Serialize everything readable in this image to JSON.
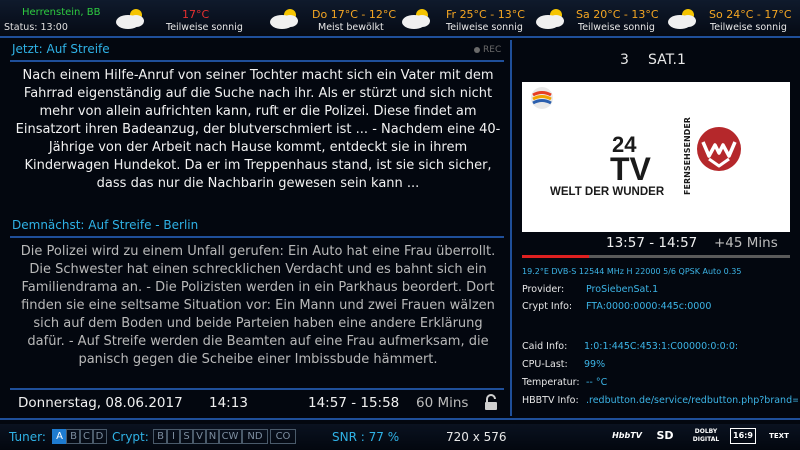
{
  "header": {
    "location": "Herrenstein, BB",
    "status": "Status: 13:00",
    "current_temp": "17°C",
    "current_desc": "Teilweise sonnig",
    "forecast": [
      {
        "day": "Do",
        "temp": "17°C - 12°C",
        "desc": "Meist bewölkt",
        "icon": "cloud-sun-icon"
      },
      {
        "day": "Fr",
        "temp": "25°C - 13°C",
        "desc": "Teilweise sonnig",
        "icon": "cloud-sun-icon"
      },
      {
        "day": "Sa",
        "temp": "20°C - 13°C",
        "desc": "Teilweise sonnig",
        "icon": "cloud-sun-icon"
      },
      {
        "day": "So",
        "temp": "24°C - 17°C",
        "desc": "Teilweise sonnig",
        "icon": "cloud-sun-icon"
      }
    ]
  },
  "now": {
    "title": "Jetzt: Auf Streife",
    "rec": "REC",
    "description": "Nach einem Hilfe-Anruf von seiner  Tochter macht sich ein Vater mit dem Fahrrad eigenständig auf die Suche nach ihr. Als er stürzt und sich nicht mehr von allein aufrichten kann, ruft er die Polizei. Diese findet am Einsatzort ihren Badeanzug, der blutverschmiert ist ... - Nachdem eine 40-Jährige von der Arbeit nach Hause kommt, entdeckt sie in ihrem Kinderwagen Hundekot. Da er im Treppenhaus stand, ist sie sich sicher, dass das nur die Nachbarin gewesen sein kann ..."
  },
  "next": {
    "title": "Demnächst: Auf Streife - Berlin",
    "description": "Die Polizei wird zu einem Unfall gerufen: Ein Auto hat eine Frau überrollt. Die Schwester hat einen schrecklichen Verdacht und es bahnt sich ein Familiendrama an. - Die Polizisten werden in ein Parkhaus beordert. Dort finden sie eine seltsame Situation vor: Ein Mann und zwei Frauen wälzen sich auf dem Boden und beide Parteien haben eine andere Erklärung dafür. - Auf Streife werden die Beamten auf eine Frau aufmerksam, die panisch gegen die Scheibe einer Imbissbude hämmert."
  },
  "datebar": {
    "date": "Donnerstag, 08.06.2017",
    "clock": "14:13",
    "next_time": "14:57 - 15:58",
    "next_duration": "60 Mins",
    "lock_icon": "lock-icon"
  },
  "channel": {
    "number": "3",
    "name": "SAT.1",
    "preview_logo_24": "24",
    "preview_logo_tv": "TV",
    "preview_logo_side": "FERNSEHSENDER",
    "preview_logo_sub": "WELT DER WUNDER",
    "time_range": "13:57 - 14:57",
    "remaining": "+45 Mins",
    "progress": 0.25,
    "transponder": "19.2°E  DVB-S  12544 MHz H 22000 5/6 QPSK  Auto 0.35",
    "info": [
      {
        "label": "Provider:",
        "value": "ProSiebenSat.1"
      },
      {
        "label": "Crypt Info:",
        "value": "FTA:0000:0000:445c:0000"
      },
      {
        "label": "Caid Info:",
        "value": "1:0:1:445C:453:1:C00000:0:0:0:"
      },
      {
        "label": "CPU-Last:",
        "value": "99%"
      },
      {
        "label": "Temperatur:",
        "value": "-- °C"
      },
      {
        "label": "HBBTV Info:",
        "value": ".redbutton.de/service/redbutton.php?brand="
      }
    ]
  },
  "footer": {
    "tuner_label": "Tuner:",
    "tuners": [
      "A",
      "B",
      "C",
      "D"
    ],
    "active_tuner": "A",
    "crypt_label": "Crypt:",
    "crypts": [
      "B",
      "I",
      "S",
      "V",
      "N",
      "CW",
      "ND",
      "CO"
    ],
    "snr": "SNR : 77 %",
    "resolution": "720 x 576",
    "badges": [
      "HbbTV",
      "SD",
      "DOLBY DIGITAL",
      "16:9",
      "TEXT"
    ]
  },
  "colors": {
    "accent": "#2fb2e6",
    "panel_border": "#1f4f9a",
    "location": "#2ecc40",
    "current_temp": "#e53030",
    "forecast_temp": "#f5a623",
    "progress_fill": "#e02020"
  }
}
